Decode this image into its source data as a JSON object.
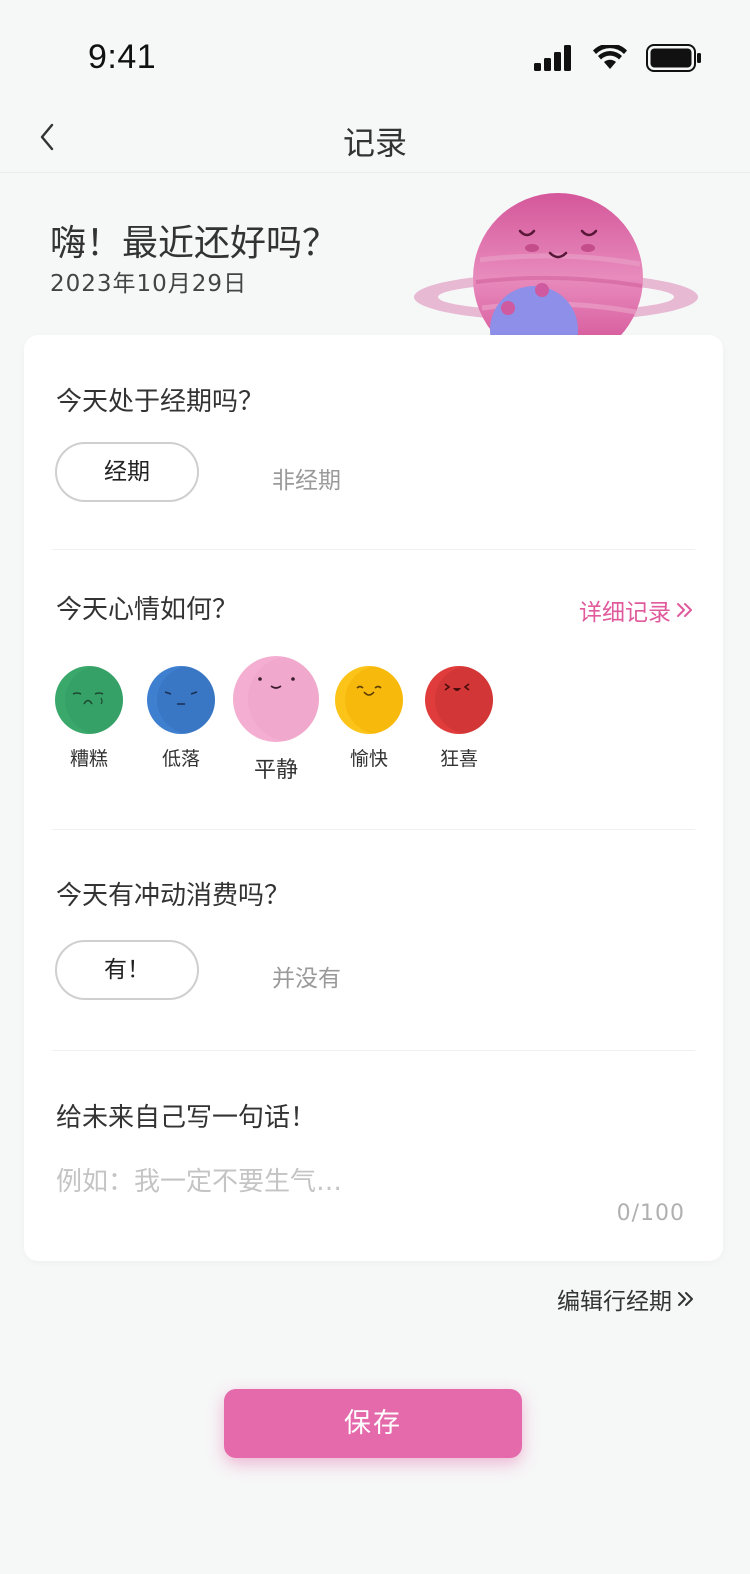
{
  "status": {
    "time": "9:41"
  },
  "nav": {
    "title": "记录"
  },
  "greeting": {
    "text": "嗨！最近还好吗？",
    "date": "2023年10月29日"
  },
  "period": {
    "question": "今天处于经期吗？",
    "options": [
      "经期",
      "非经期"
    ],
    "selected": "经期"
  },
  "mood": {
    "question": "今天心情如何？",
    "detail_link": "详细记录",
    "options": [
      {
        "label": "糟糕",
        "color": "#3aa86b"
      },
      {
        "label": "低落",
        "color": "#3f7fcf"
      },
      {
        "label": "平静",
        "color": "#f4aed2"
      },
      {
        "label": "愉快",
        "color": "#fcc419"
      },
      {
        "label": "狂喜",
        "color": "#e03c3c"
      }
    ],
    "selected": "平静"
  },
  "spending": {
    "question": "今天有冲动消费吗？",
    "options": [
      "有！",
      "并没有"
    ],
    "selected": "有！"
  },
  "note": {
    "question": "给未来自己写一句话！",
    "placeholder": "例如：我一定不要生气…",
    "counter": "0/100"
  },
  "edit_link": "编辑行经期",
  "save_label": "保存",
  "colors": {
    "accent": "#e46aab",
    "link": "#e05a9c"
  }
}
